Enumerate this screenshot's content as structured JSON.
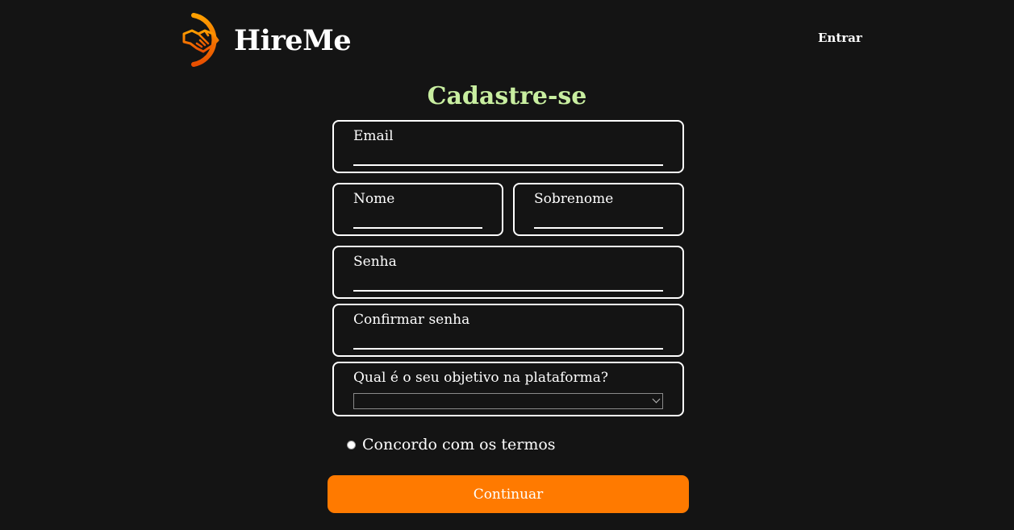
{
  "header": {
    "brand": "HireMe",
    "login_label": "Entrar"
  },
  "form": {
    "title": "Cadastre-se",
    "email": {
      "label": "Email",
      "value": ""
    },
    "first_name": {
      "label": "Nome",
      "value": ""
    },
    "last_name": {
      "label": "Sobrenome",
      "value": ""
    },
    "password": {
      "label": "Senha",
      "value": ""
    },
    "confirm_password": {
      "label": "Confirmar senha",
      "value": ""
    },
    "goal": {
      "label": "Qual é o seu objetivo na plataforma?",
      "selected": ""
    },
    "terms_label": "Concordo com os termos",
    "continue_label": "Continuar"
  },
  "colors": {
    "background": "#141414",
    "title": "#c8eea0",
    "accent": "#ff7a00",
    "border": "#ffffff"
  },
  "icons": {
    "logo": "handshake-icon"
  }
}
